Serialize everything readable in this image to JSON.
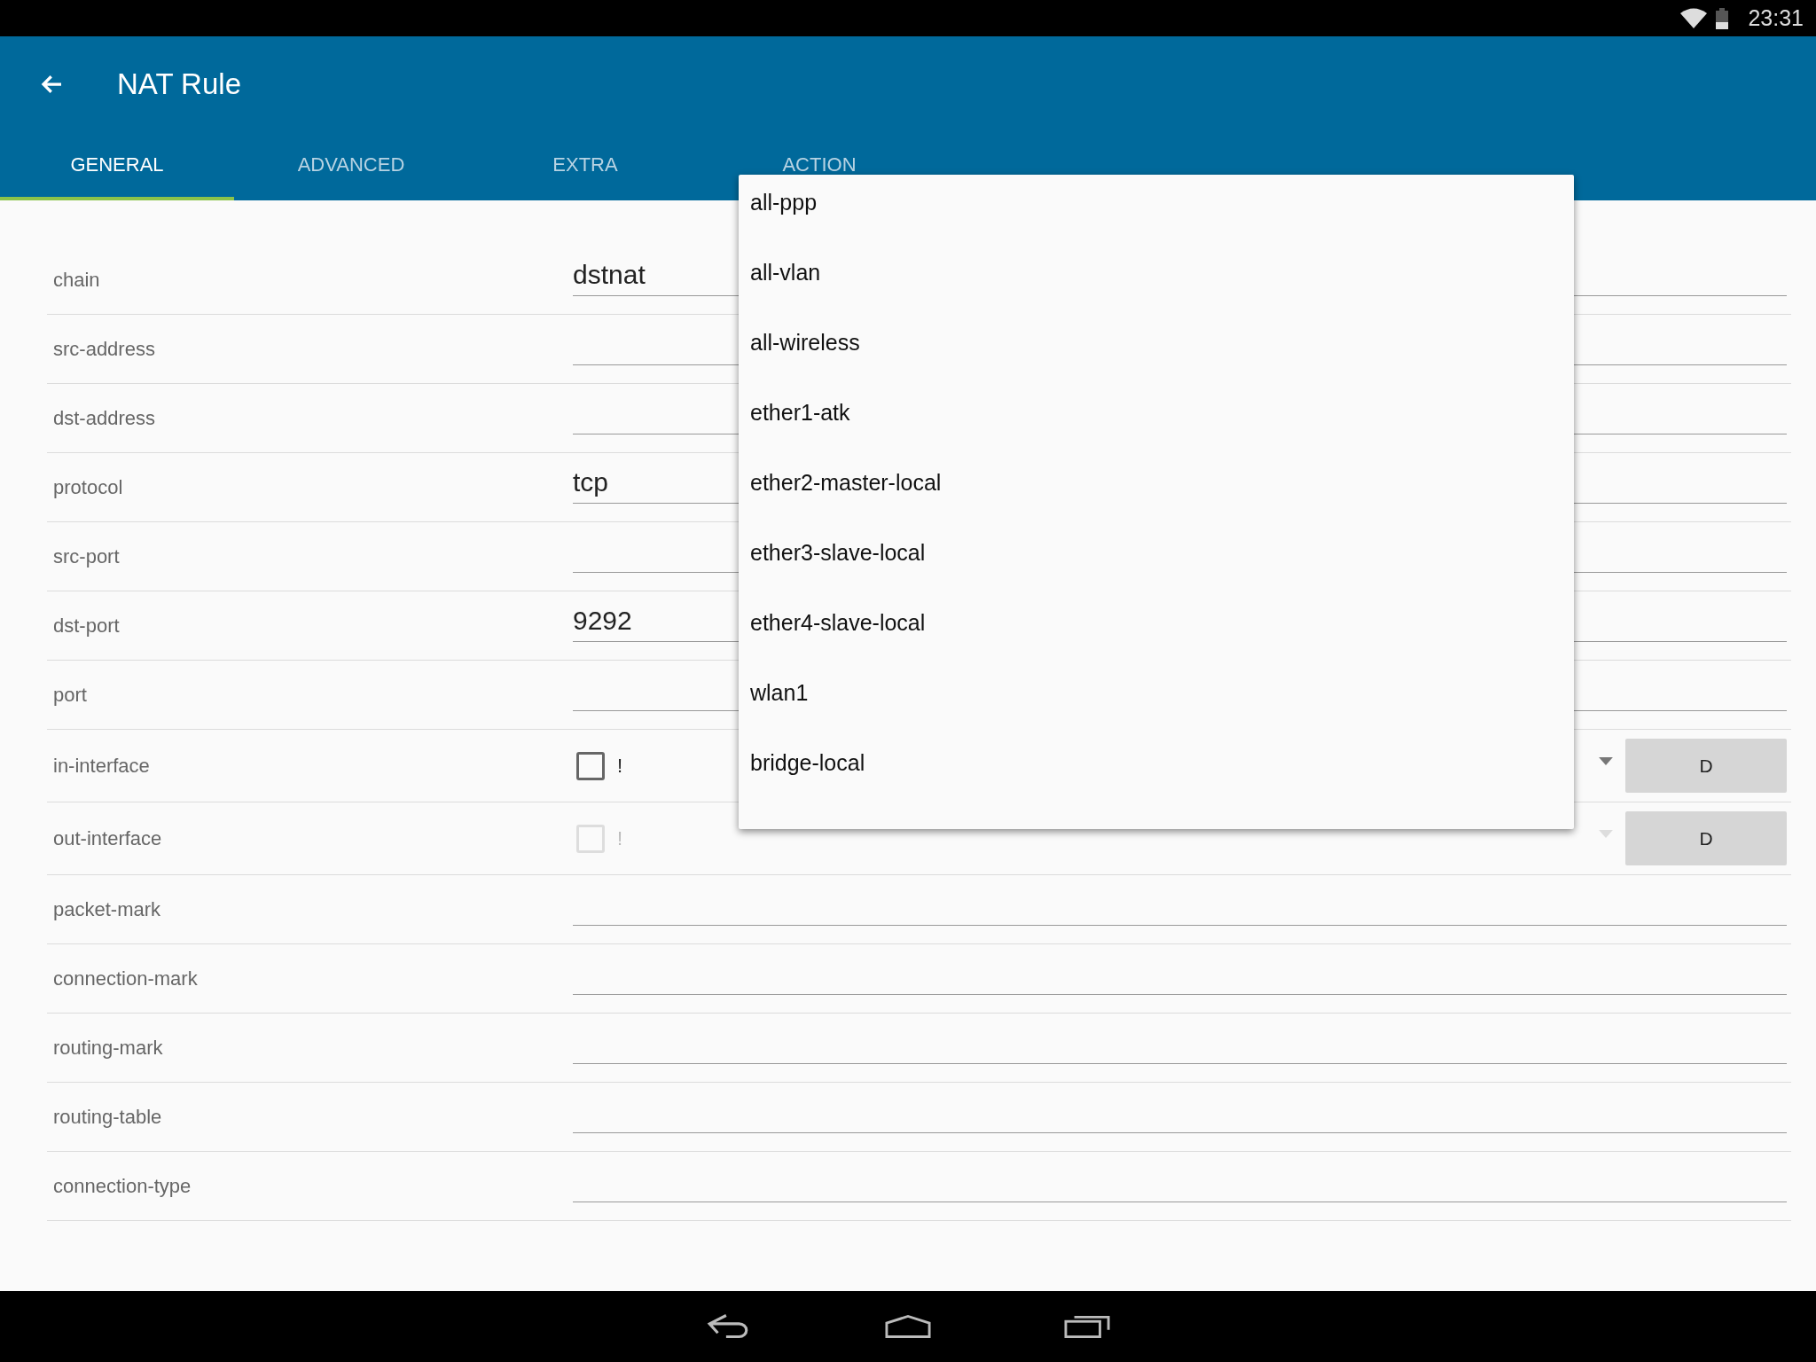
{
  "status_bar": {
    "time": "23:31"
  },
  "app_bar": {
    "title": "NAT Rule"
  },
  "tabs": [
    {
      "label": "GENERAL",
      "selected": true
    },
    {
      "label": "ADVANCED",
      "selected": false
    },
    {
      "label": "EXTRA",
      "selected": false
    },
    {
      "label": "ACTION",
      "selected": false
    }
  ],
  "rows": [
    {
      "kind": "text",
      "label": "chain",
      "value": "dstnat"
    },
    {
      "kind": "text",
      "label": "src-address"
    },
    {
      "kind": "text",
      "label": "dst-address"
    },
    {
      "kind": "text",
      "label": "protocol",
      "value": "tcp"
    },
    {
      "kind": "text",
      "label": "src-port"
    },
    {
      "kind": "text",
      "label": "dst-port",
      "value": "9292"
    },
    {
      "kind": "text",
      "label": "port"
    },
    {
      "kind": "select",
      "label": "in-interface",
      "negate": "!",
      "checked": false,
      "disabled": false,
      "button": "D"
    },
    {
      "kind": "select",
      "label": "out-interface",
      "negate": "!",
      "checked": false,
      "disabled": true,
      "button": "D"
    },
    {
      "kind": "text",
      "label": "packet-mark"
    },
    {
      "kind": "text",
      "label": "connection-mark"
    },
    {
      "kind": "text",
      "label": "routing-mark"
    },
    {
      "kind": "text",
      "label": "routing-table"
    },
    {
      "kind": "text",
      "label": "connection-type"
    }
  ],
  "dropdown_menu": {
    "items": [
      "all-ppp",
      "all-vlan",
      "all-wireless",
      "ether1-atk",
      "ether2-master-local",
      "ether3-slave-local",
      "ether4-slave-local",
      "wlan1",
      "bridge-local"
    ]
  }
}
